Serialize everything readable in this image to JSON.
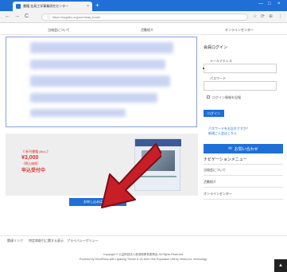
{
  "browser": {
    "tab_title": "書籍 金具工学事業研究センター",
    "tab_close": "×",
    "new_tab": "+",
    "url": "https://sugaku.org/oominas_book/",
    "back": "←",
    "forward": "→",
    "reload": "C",
    "lock": "ⓘ",
    "minimize": "—",
    "maximize": "□",
    "close": "×",
    "tools": [
      "☆",
      "⟳",
      "⊕",
      "⋮"
    ]
  },
  "sitenav": {
    "items": [
      "当協会について",
      "活動紹介",
      "オンラインセンター"
    ]
  },
  "book": {
    "label": "《 新刊書籍 (Blu) 》",
    "price": "¥3,000",
    "tax": "（税込価格）",
    "status": "申込受付中"
  },
  "apply_button": "お申し込みはこちら",
  "sidebar": {
    "login_heading": "会員ログイン",
    "email_label": "メールアドレス",
    "password_label": "パスワード",
    "remember_label": "ログイン情報を記憶",
    "login_button": "ログイン",
    "forgot_link": "パスワードをお忘れですか？",
    "register_link": "新規ご入会はこちら",
    "contact_button": "お問い合わせ",
    "contact_icon": "✉",
    "nav_heading": "ナビゲーションメニュー",
    "nav_items": [
      "当協会について",
      "活動紹介",
      "オンラインセンター"
    ]
  },
  "footer": {
    "links": [
      "関連リンク",
      "特定商取引に関する表示",
      "プライバシーポリシー"
    ],
    "copyright": "Copyright © 公益財団法人新潟県教育振興会 All Rights Reserved.",
    "powered": "Powered by WordPress with Lightning Theme & VK All in One Expansion Unit by Vektor,Inc. technology.",
    "pagetop": "▲"
  },
  "colors": {
    "accent": "#1f6fd6",
    "price_red": "#dd3333",
    "arrow_red": "#c81e28"
  }
}
